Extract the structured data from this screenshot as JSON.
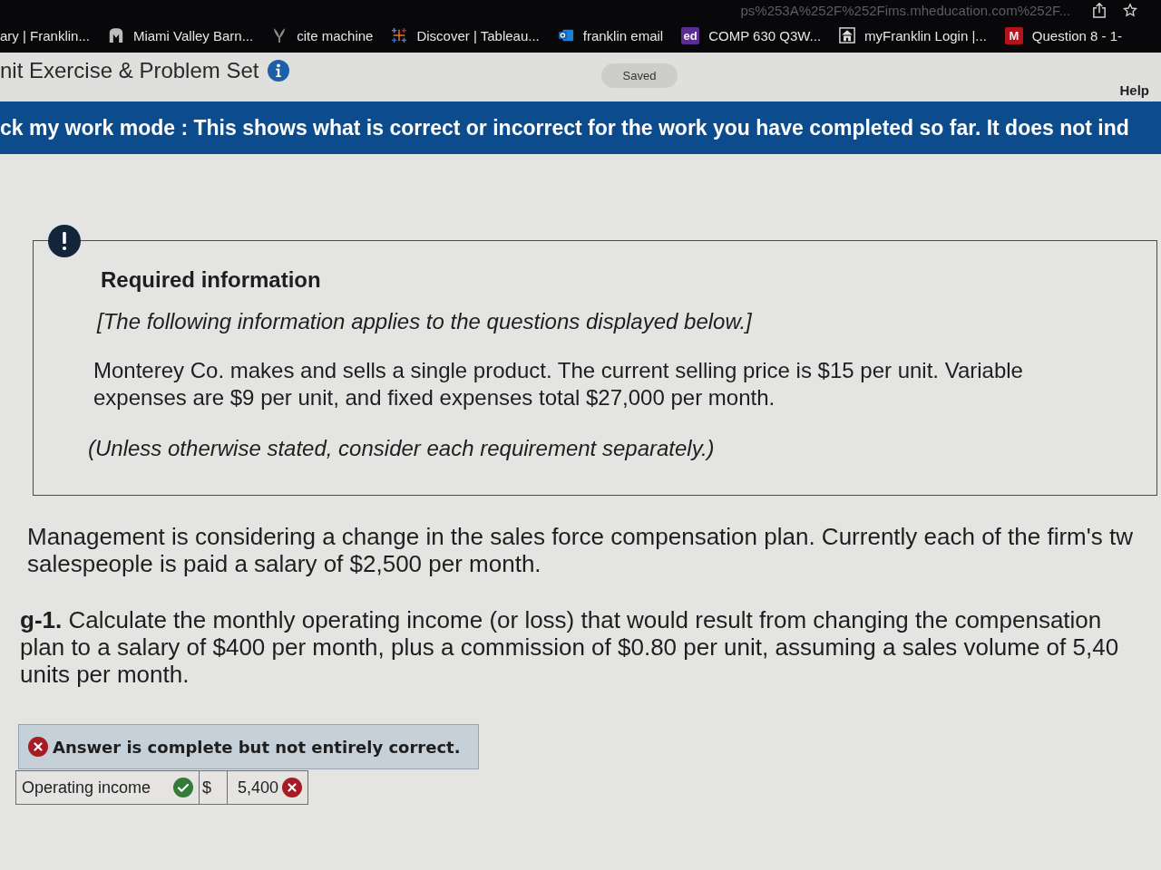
{
  "browser": {
    "url": "ps%253A%252F%252Fims.mheducation.com%252F...",
    "bookmarks": [
      {
        "kind": "none",
        "label": "ary | Franklin..."
      },
      {
        "kind": "arch",
        "label": "Miami Valley Barn..."
      },
      {
        "kind": "sprout",
        "label": "cite machine"
      },
      {
        "kind": "plus-cluster",
        "label": "Discover | Tableau..."
      },
      {
        "kind": "ring-tile",
        "label": "franklin email"
      },
      {
        "kind": "letter-tile",
        "logo_text": "ed",
        "color": "#5b2d91",
        "label": "COMP 630 Q3W..."
      },
      {
        "kind": "building",
        "label": "myFranklin Login |..."
      },
      {
        "kind": "letter-tile",
        "logo_text": "M",
        "color": "#b3141b",
        "label": "Question 8 - 1-"
      }
    ]
  },
  "header": {
    "title": "nit Exercise & Problem Set",
    "save_status": "Saved",
    "help": "Help"
  },
  "banner": {
    "text": "ck my work mode : This shows what is correct or incorrect for the work you have completed so far. It does not ind"
  },
  "info_card": {
    "heading": "Required information",
    "note": "[The following information applies to the questions displayed below.]",
    "body": "Monterey Co. makes and sells a single product. The current selling price is $15 per unit. Variable expenses are $9 per unit, and fixed expenses total $27,000 per month.",
    "footnote": "(Unless otherwise stated, consider each requirement separately.)"
  },
  "scenario_lines": [
    "Management is considering a change in the sales force compensation plan. Currently each of the firm's tw",
    "salespeople is paid a salary of $2,500 per month."
  ],
  "question_lines": [
    "**g-1.** Calculate the monthly operating income (or loss) that would result from changing the compensation",
    "plan to a salary of $400 per month, plus a commission of $0.80 per unit, assuming a sales volume of 5,40",
    "units per month."
  ],
  "answer": {
    "correct": false,
    "message": "Answer is complete but not entirely correct.",
    "rows": [
      {
        "label": "Operating income",
        "label_correct": true,
        "currency": "$",
        "value": "5,400",
        "value_correct": false
      }
    ]
  }
}
